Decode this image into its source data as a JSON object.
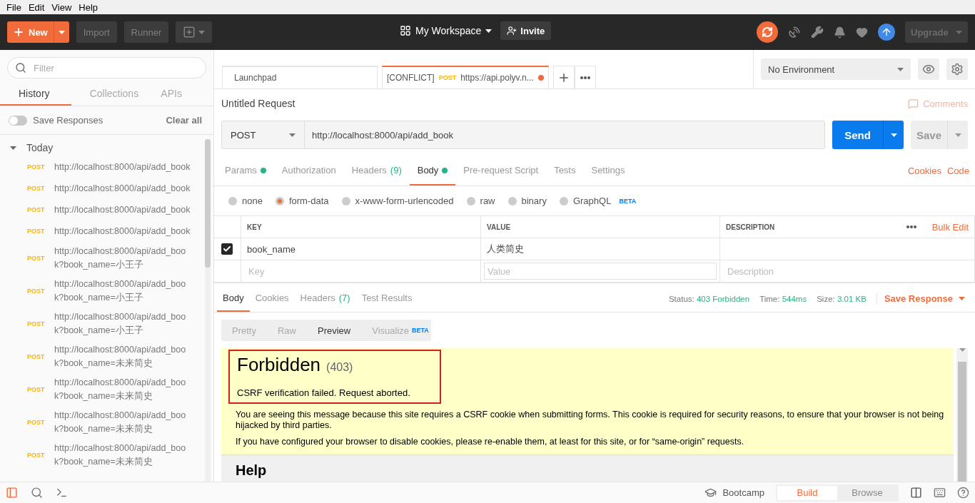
{
  "menu": [
    "File",
    "Edit",
    "View",
    "Help"
  ],
  "header": {
    "new_label": "New",
    "buttons": [
      "Import",
      "Runner"
    ],
    "workspace": "My Workspace",
    "invite": "Invite",
    "upgrade": "Upgrade"
  },
  "sidebar": {
    "filter_placeholder": "Filter",
    "tabs": [
      {
        "label": "History",
        "selected": true
      },
      {
        "label": "Collections",
        "selected": false
      },
      {
        "label": "APIs",
        "selected": false
      }
    ],
    "save_responses": {
      "label": "Save Responses",
      "on": false
    },
    "clear_all": "Clear all",
    "groups": [
      {
        "label": "Today",
        "expanded": true,
        "items": [
          {
            "method": "POST",
            "url": "http://localhost:8000/api/add_book"
          },
          {
            "method": "POST",
            "url": "http://localhost:8000/api/add_book"
          },
          {
            "method": "POST",
            "url": "http://localhost:8000/api/add_book"
          },
          {
            "method": "POST",
            "url": "http://localhost:8000/api/add_book"
          },
          {
            "method": "POST",
            "url": "http://localhost:8000/api/add_book?book_name=小王子"
          },
          {
            "method": "POST",
            "url": "http://localhost:8000/api/add_book?book_name=小王子"
          },
          {
            "method": "POST",
            "url": "http://localhost:8000/api/add_book?book_name=小王子"
          },
          {
            "method": "POST",
            "url": "http://localhost:8000/api/add_book?book_name=未来简史"
          },
          {
            "method": "POST",
            "url": "http://localhost:8000/api/add_book?book_name=未来简史"
          },
          {
            "method": "POST",
            "url": "http://localhost:8000/api/add_book?book_name=未来简史"
          },
          {
            "method": "POST",
            "url": "http://localhost:8000/api/add_book?book_name=未来简史"
          }
        ]
      }
    ]
  },
  "tabs": [
    {
      "label": "Launchpad",
      "selected": false,
      "unsaved": false
    },
    {
      "prefix": "[CONFLICT]",
      "method": "POST",
      "label": "https://api.polyv.n...",
      "selected": true,
      "unsaved": true
    }
  ],
  "environment": "No Environment",
  "request": {
    "title": "Untitled Request",
    "comments": "Comments",
    "method": "POST",
    "url": "http://localhost:8000/api/add_book",
    "send": "Send",
    "save": "Save"
  },
  "request_tabs": [
    {
      "label": "Params",
      "dot": true,
      "selected": false
    },
    {
      "label": "Authorization",
      "dot": false,
      "selected": false
    },
    {
      "label": "Headers",
      "count": "(9)",
      "dot": false,
      "selected": false
    },
    {
      "label": "Body",
      "dot": true,
      "selected": true
    },
    {
      "label": "Pre-request Script",
      "dot": false,
      "selected": false
    },
    {
      "label": "Tests",
      "dot": false,
      "selected": false
    },
    {
      "label": "Settings",
      "dot": false,
      "selected": false
    }
  ],
  "request_links": [
    "Cookies",
    "Code"
  ],
  "body_types": [
    {
      "label": "none",
      "selected": false
    },
    {
      "label": "form-data",
      "selected": true
    },
    {
      "label": "x-www-form-urlencoded",
      "selected": false
    },
    {
      "label": "raw",
      "selected": false
    },
    {
      "label": "binary",
      "selected": false
    },
    {
      "label": "GraphQL",
      "badge": "BETA",
      "selected": false
    }
  ],
  "params": {
    "columns": [
      "KEY",
      "VALUE",
      "DESCRIPTION"
    ],
    "bulk_edit": "Bulk Edit",
    "rows": [
      {
        "checked": true,
        "key": "book_name",
        "value": "人类简史"
      }
    ],
    "new_row": {
      "key_placeholder": "Key",
      "value_placeholder": "Value",
      "description_placeholder": "Description"
    }
  },
  "response": {
    "tabs": [
      {
        "label": "Body",
        "selected": true
      },
      {
        "label": "Cookies",
        "selected": false
      },
      {
        "label": "Headers",
        "count": "(7)",
        "selected": false
      },
      {
        "label": "Test Results",
        "selected": false
      }
    ],
    "stats": [
      {
        "label": "Status:",
        "value": "403 Forbidden"
      },
      {
        "label": "Time:",
        "value": "544ms"
      },
      {
        "label": "Size:",
        "value": "3.01 KB"
      }
    ],
    "save_response": "Save Response",
    "view_tabs": [
      {
        "label": "Pretty",
        "selected": false
      },
      {
        "label": "Raw",
        "selected": false
      },
      {
        "label": "Preview",
        "selected": true
      },
      {
        "label": "Visualize",
        "badge": "BETA",
        "selected": false
      }
    ],
    "preview": {
      "title": "Forbidden",
      "code": "(403)",
      "reason": "CSRF verification failed. Request aborted.",
      "paragraphs": [
        "You are seeing this message because this site requires a CSRF cookie when submitting forms. This cookie is required for security reasons, to ensure that your browser is not being hijacked by third parties.",
        "If you have configured your browser to disable cookies, please re-enable them, at least for this site, or for “same-origin” requests."
      ],
      "help": "Help"
    }
  },
  "footer": {
    "bootcamp": "Bootcamp",
    "modes": [
      {
        "label": "Build",
        "selected": true
      },
      {
        "label": "Browse",
        "selected": false
      }
    ]
  }
}
